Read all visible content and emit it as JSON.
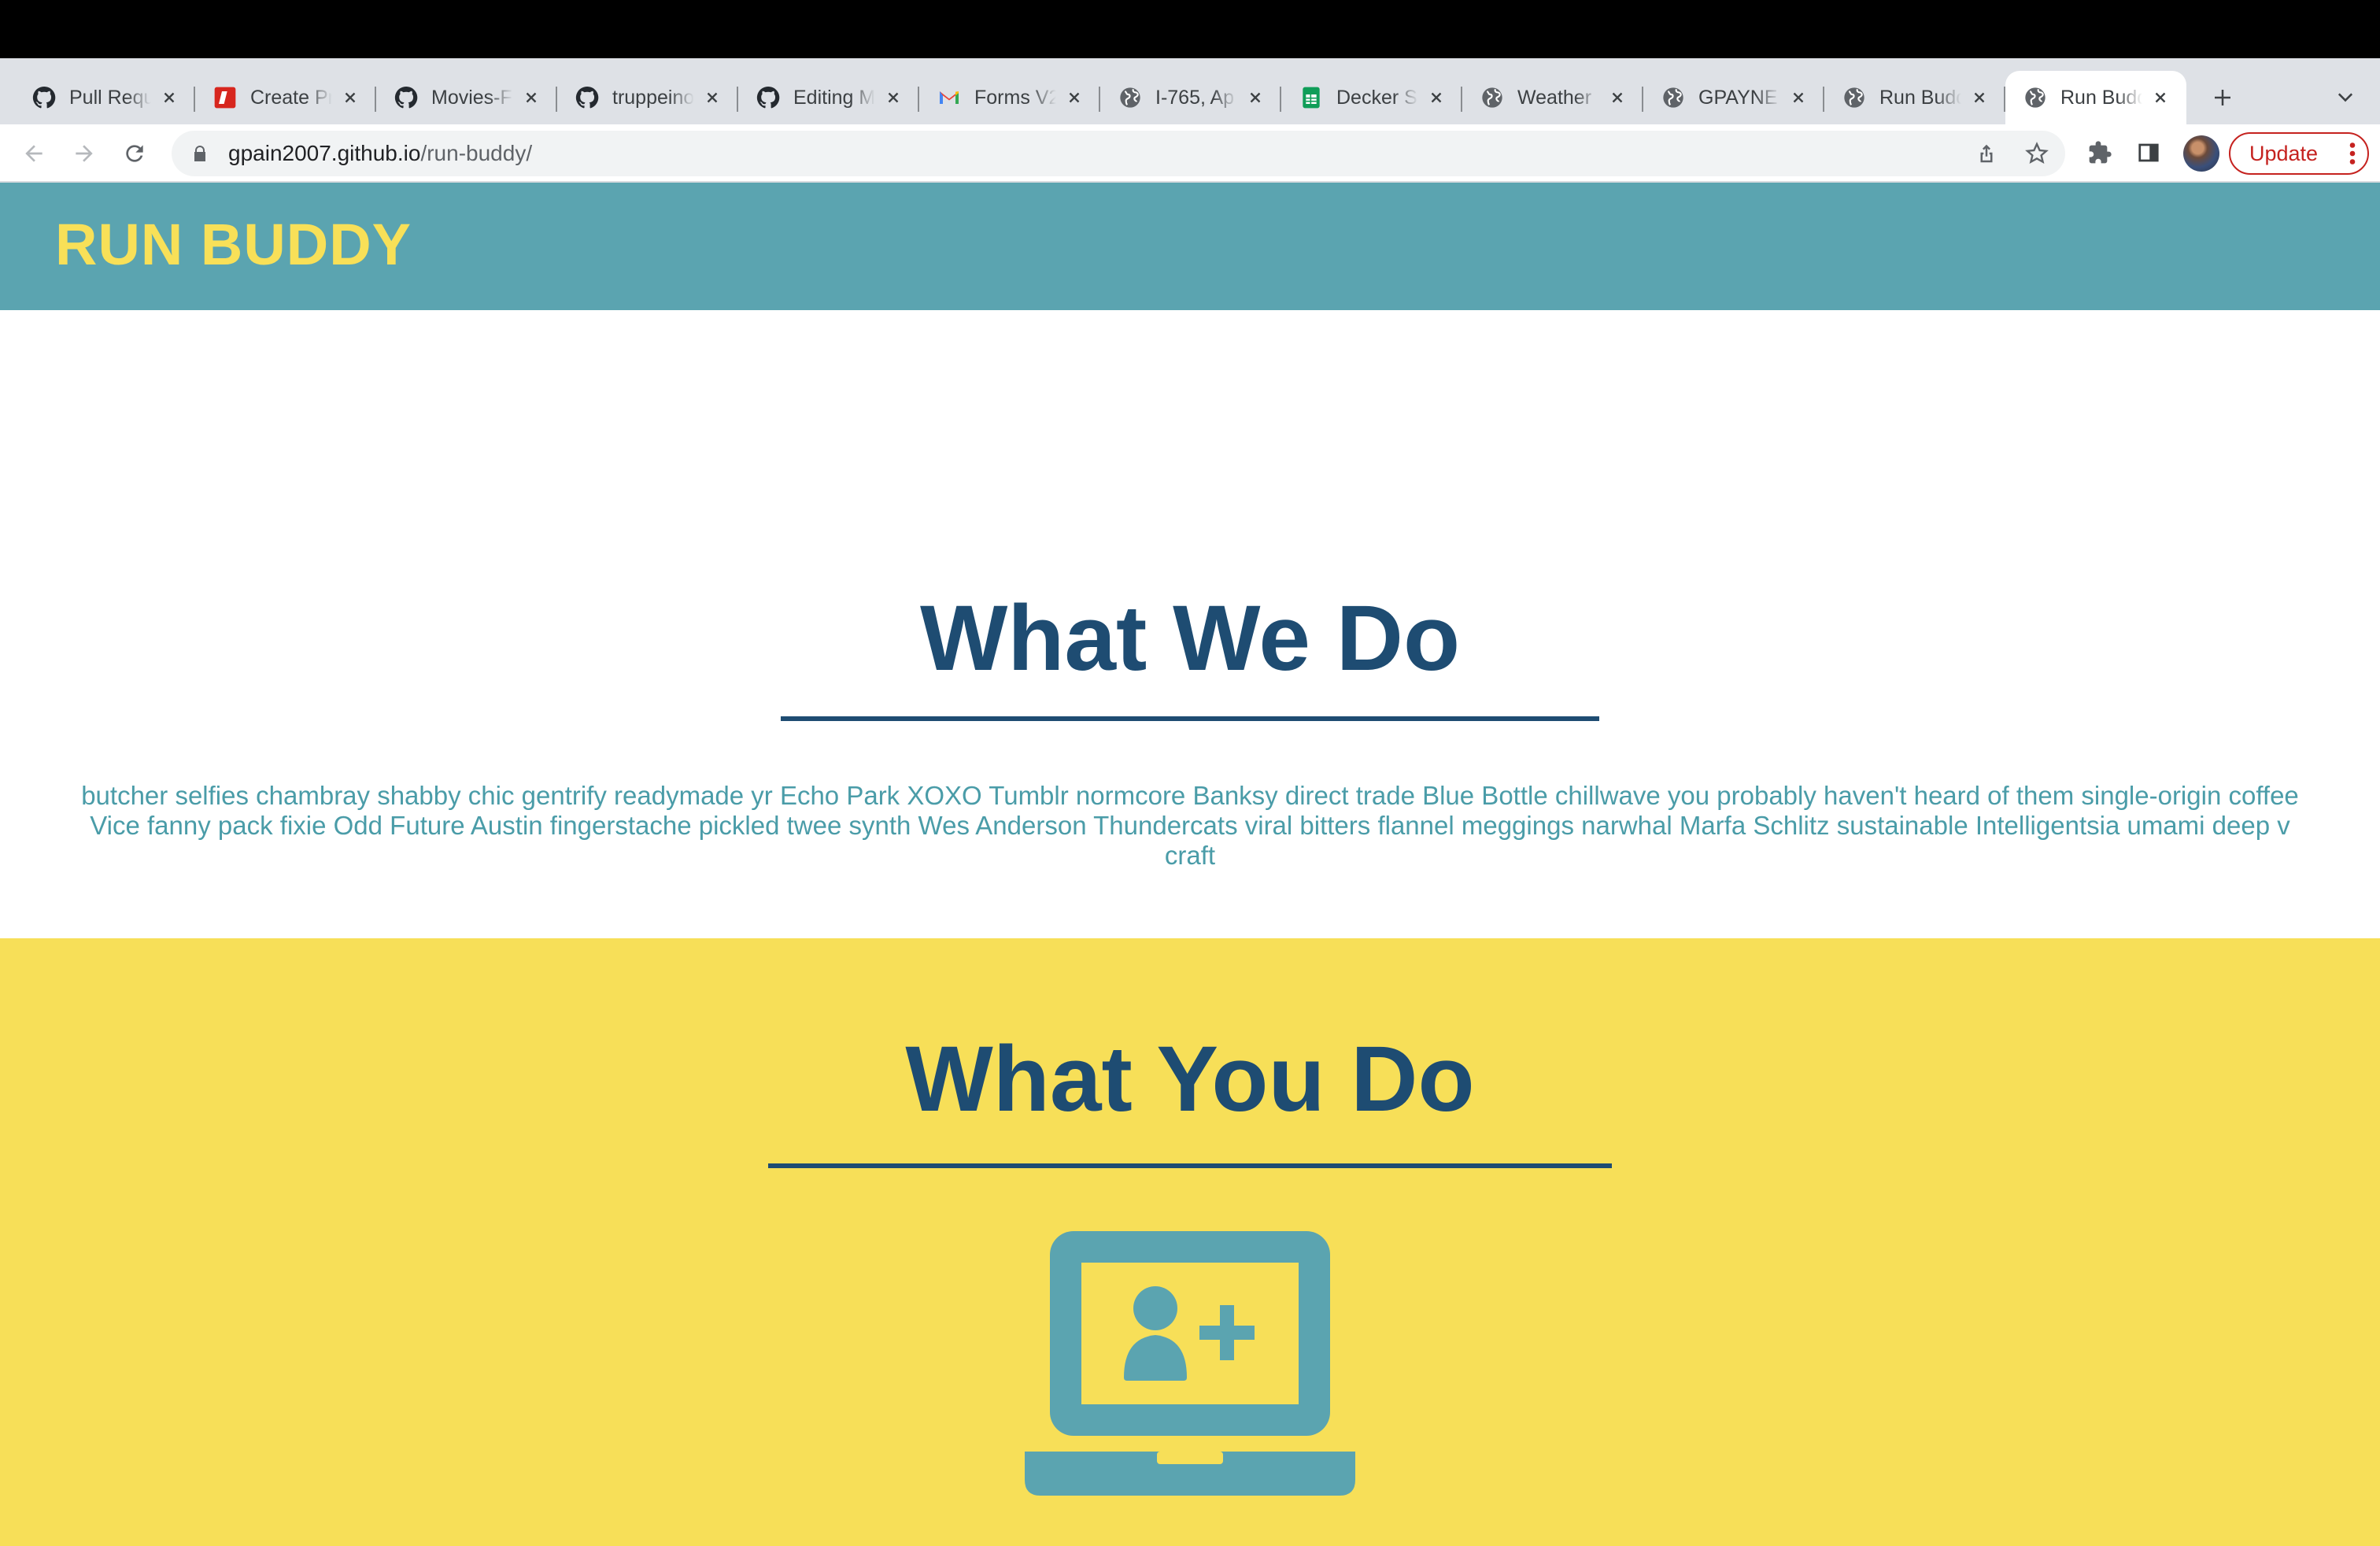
{
  "browser": {
    "tabs": [
      {
        "title": "Pull Requ",
        "icon": "github-icon",
        "active": false
      },
      {
        "title": "Create Pr",
        "icon": "dev-icon",
        "active": false
      },
      {
        "title": "Movies-F",
        "icon": "github-icon",
        "active": false
      },
      {
        "title": "truppeino",
        "icon": "github-icon",
        "active": false
      },
      {
        "title": "Editing M",
        "icon": "github-icon",
        "active": false
      },
      {
        "title": "Forms V2",
        "icon": "gmail-icon",
        "active": false
      },
      {
        "title": "I-765, Ap",
        "icon": "globe-icon",
        "active": false
      },
      {
        "title": "Decker S",
        "icon": "sheets-icon",
        "active": false
      },
      {
        "title": "Weather",
        "icon": "globe-icon",
        "active": false
      },
      {
        "title": "GPAYNE",
        "icon": "globe-icon",
        "active": false
      },
      {
        "title": "Run Budd",
        "icon": "globe-icon",
        "active": false
      },
      {
        "title": "Run Budd",
        "icon": "globe-icon",
        "active": true
      }
    ],
    "url_host": "gpain2007.github.io",
    "url_path": "/run-buddy/",
    "update_label": "Update",
    "colors": {
      "update": "#c5221f",
      "tabstrip": "#dee1e6"
    }
  },
  "site": {
    "title": "RUN BUDDY",
    "what_we_do": {
      "heading": "What We Do",
      "line1": "butcher selfies chambray shabby chic gentrify readymade yr Echo Park XOXO Tumblr normcore Banksy direct trade Blue Bottle chillwave you probably haven't heard of them single-origin coffee",
      "line2": "Vice fanny pack fixie Odd Future Austin fingerstache pickled twee synth Wes Anderson Thundercats viral bitters flannel meggings narwhal Marfa Schlitz sustainable Intelligentsia umami deep v craft"
    },
    "what_you_do": {
      "heading": "What You Do",
      "icon": "laptop-add-user-icon"
    },
    "colors": {
      "header_bg": "#5ba4b0",
      "title": "#f8e058",
      "heading": "#1e4c72",
      "body_text": "#4a9ca8",
      "yellow_bg": "#f7df58"
    }
  }
}
